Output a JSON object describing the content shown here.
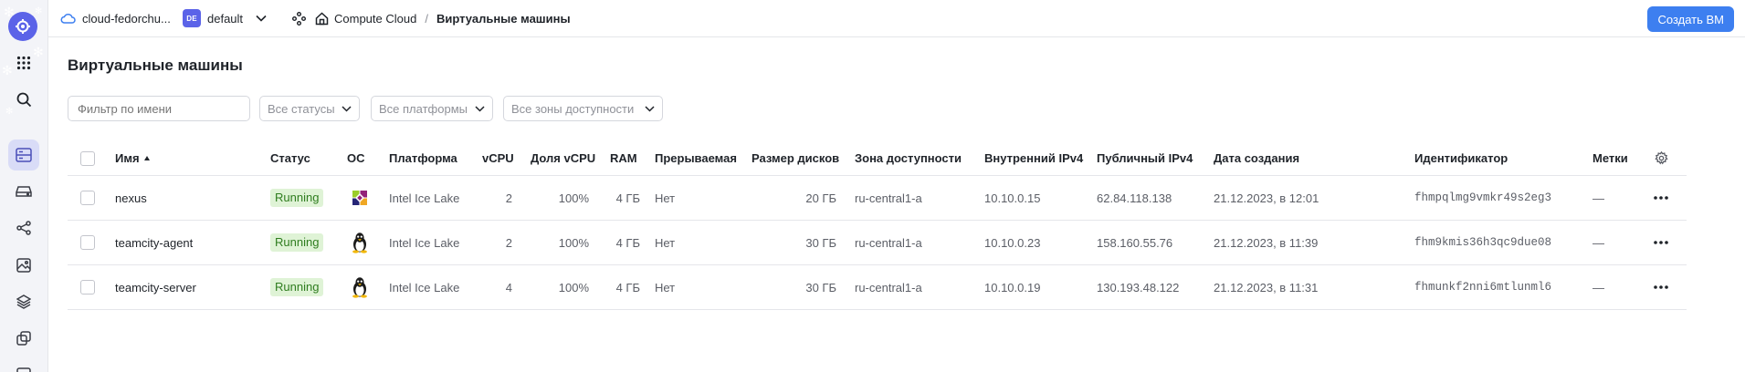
{
  "header": {
    "cloud_name": "cloud-fedorchu...",
    "folder_badge": "DE",
    "folder_name": "default",
    "breadcrumb_service": "Compute Cloud",
    "breadcrumb_separator": "/",
    "breadcrumb_page": "Виртуальные машины",
    "create_button": "Создать ВМ"
  },
  "page": {
    "title": "Виртуальные машины"
  },
  "filters": {
    "name_placeholder": "Фильтр по имени",
    "status": "Все статусы",
    "platform": "Все платформы",
    "zone": "Все зоны доступности"
  },
  "table": {
    "columns": {
      "name": "Имя",
      "status": "Статус",
      "os": "ОС",
      "platform": "Платформа",
      "vcpu": "vCPU",
      "vcpu_share": "Доля vCPU",
      "ram": "RAM",
      "preemptible": "Прерываемая",
      "disk_size": "Размер дисков",
      "zone": "Зона доступности",
      "internal_ip": "Внутренний IPv4",
      "public_ip": "Публичный IPv4",
      "created": "Дата создания",
      "id": "Идентификатор",
      "labels": "Метки"
    },
    "rows": [
      {
        "name": "nexus",
        "status": "Running",
        "os_icon": "centos-icon",
        "platform": "Intel Ice Lake",
        "vcpu": "2",
        "vcpu_share": "100%",
        "ram": "4 ГБ",
        "preemptible": "Нет",
        "disk_size": "20 ГБ",
        "zone": "ru-central1-a",
        "internal_ip": "10.10.0.15",
        "public_ip": "62.84.118.138",
        "created": "21.12.2023, в 12:01",
        "id": "fhmpqlmg9vmkr49s2eg3",
        "labels": "—"
      },
      {
        "name": "teamcity-agent",
        "status": "Running",
        "os_icon": "linux-tux-icon",
        "platform": "Intel Ice Lake",
        "vcpu": "2",
        "vcpu_share": "100%",
        "ram": "4 ГБ",
        "preemptible": "Нет",
        "disk_size": "30 ГБ",
        "zone": "ru-central1-a",
        "internal_ip": "10.10.0.23",
        "public_ip": "158.160.55.76",
        "created": "21.12.2023, в 11:39",
        "id": "fhm9kmis36h3qc9due08",
        "labels": "—"
      },
      {
        "name": "teamcity-server",
        "status": "Running",
        "os_icon": "linux-tux-icon",
        "platform": "Intel Ice Lake",
        "vcpu": "4",
        "vcpu_share": "100%",
        "ram": "4 ГБ",
        "preemptible": "Нет",
        "disk_size": "30 ГБ",
        "zone": "ru-central1-a",
        "internal_ip": "10.10.0.19",
        "public_ip": "130.193.48.122",
        "created": "21.12.2023, в 11:31",
        "id": "fhmunkf2nni6mtlunml6",
        "labels": "—"
      }
    ]
  },
  "colors": {
    "accent": "#3d7ff0",
    "brand": "#5b63e8",
    "status_running_bg": "#dff3d6",
    "status_running_text": "#2f7d1f"
  },
  "icons": {
    "rail": [
      "yandex-cloud-logo-icon",
      "apps-grid-icon",
      "search-icon",
      "compute-list-icon",
      "disk-icon",
      "network-icon",
      "image-icon",
      "layers-icon",
      "copy-icon"
    ],
    "header": [
      "cloud-icon",
      "chevron-down-icon",
      "services-icon",
      "home-icon"
    ],
    "table": [
      "settings-gear-icon",
      "more-horizontal-icon"
    ]
  }
}
